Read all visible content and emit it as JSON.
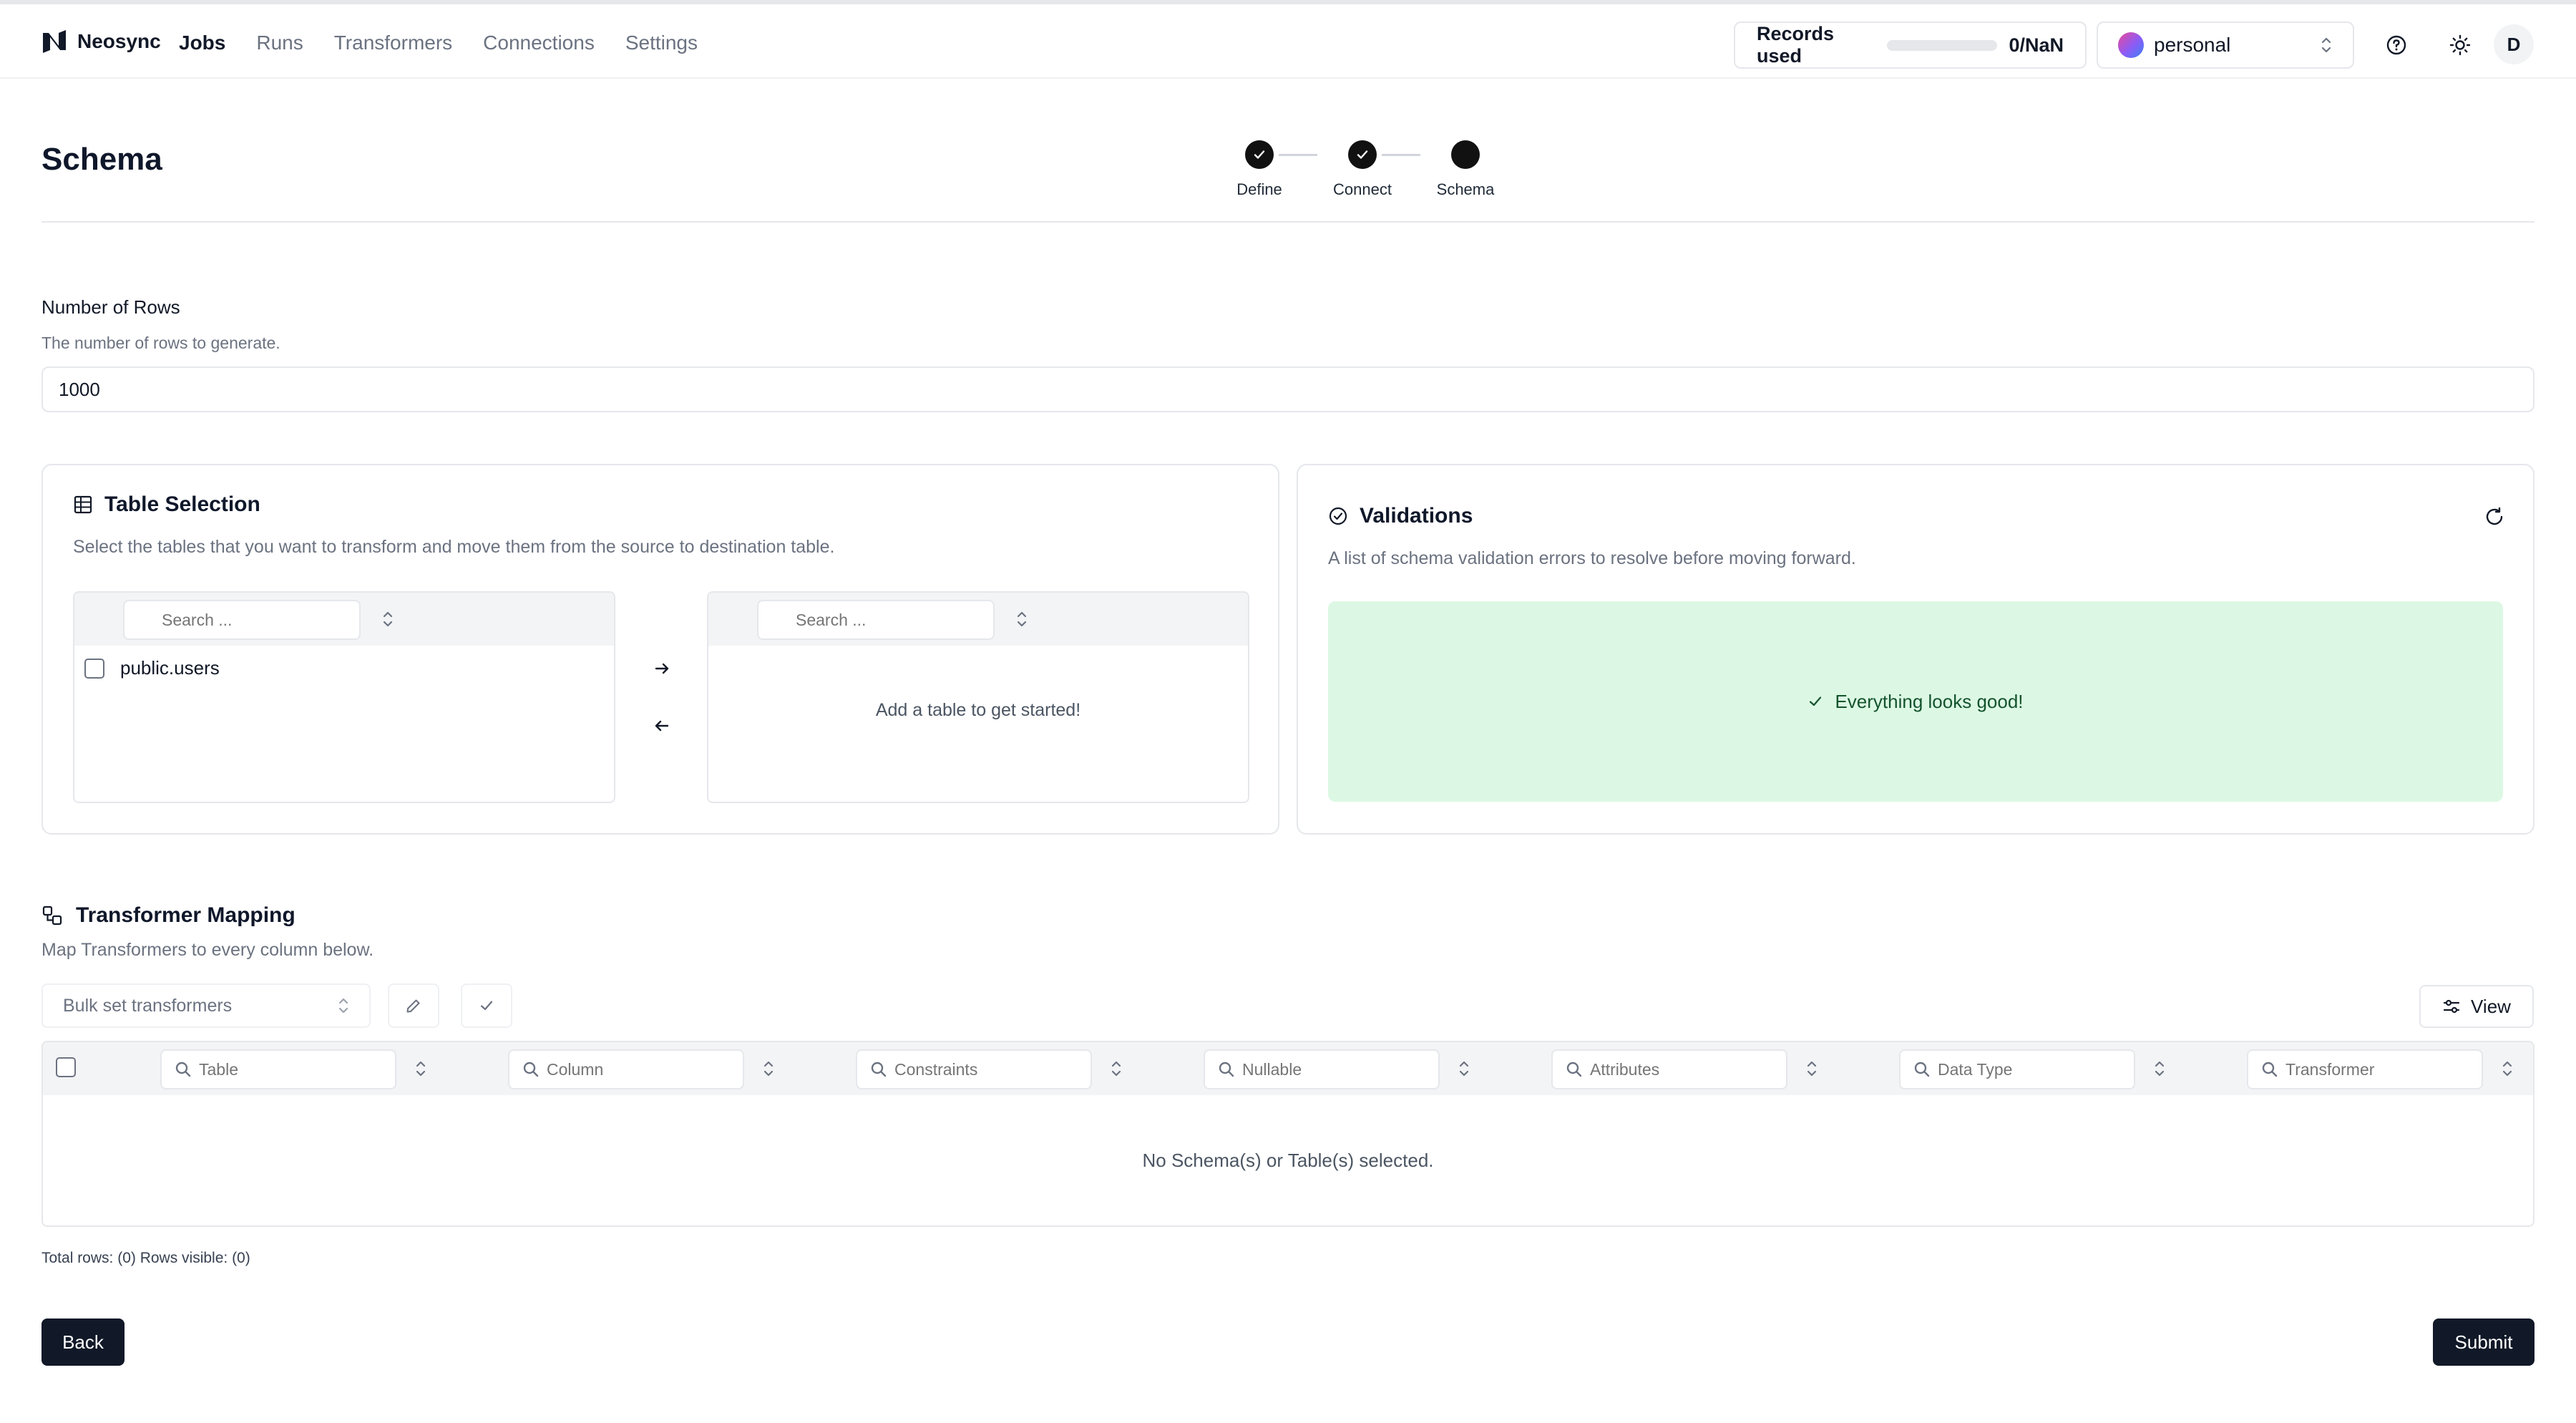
{
  "app": {
    "name": "Neosync"
  },
  "nav": {
    "links": [
      {
        "label": "Jobs",
        "active": true
      },
      {
        "label": "Runs",
        "active": false
      },
      {
        "label": "Transformers",
        "active": false
      },
      {
        "label": "Connections",
        "active": false
      },
      {
        "label": "Settings",
        "active": false
      }
    ]
  },
  "records": {
    "label": "Records used",
    "value": "0/NaN",
    "progress_fraction": 0
  },
  "account": {
    "name": "personal"
  },
  "user": {
    "initial": "D"
  },
  "page": {
    "title": "Schema"
  },
  "stepper": {
    "steps": [
      {
        "label": "Define",
        "state": "complete"
      },
      {
        "label": "Connect",
        "state": "complete"
      },
      {
        "label": "Schema",
        "state": "current"
      }
    ]
  },
  "rows_field": {
    "label": "Number of Rows",
    "description": "The number of rows to generate.",
    "value": "1000"
  },
  "table_selection": {
    "title": "Table Selection",
    "description": "Select the tables that you want to transform and move them from the source to destination table.",
    "source": {
      "search_placeholder": "Search ...",
      "items": [
        "public.users"
      ]
    },
    "destination": {
      "search_placeholder": "Search ...",
      "empty_text": "Add a table to get started!"
    }
  },
  "validations": {
    "title": "Validations",
    "description": "A list of schema validation errors to resolve before moving forward.",
    "status_text": "Everything looks good!"
  },
  "transformer_mapping": {
    "title": "Transformer Mapping",
    "description": "Map Transformers to every column below.",
    "bulk_placeholder": "Bulk set transformers",
    "view_label": "View",
    "columns": [
      {
        "placeholder": "Table"
      },
      {
        "placeholder": "Column"
      },
      {
        "placeholder": "Constraints"
      },
      {
        "placeholder": "Nullable"
      },
      {
        "placeholder": "Attributes"
      },
      {
        "placeholder": "Data Type"
      },
      {
        "placeholder": "Transformer"
      }
    ],
    "empty_text": "No Schema(s) or Table(s) selected.",
    "footer": "Total rows: (0) Rows visible: (0)"
  },
  "actions": {
    "back_label": "Back",
    "submit_label": "Submit"
  },
  "colors": {
    "primary": "#111827",
    "success_bg": "#dcf8e4",
    "border": "#e5e7eb",
    "muted_text": "#6b7280"
  }
}
